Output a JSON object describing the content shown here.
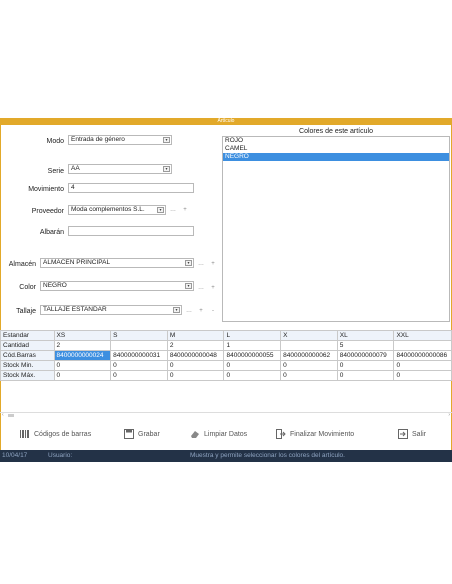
{
  "window": {
    "title": "Artículo"
  },
  "form": {
    "modo": {
      "label": "Modo",
      "value": "Entrada de género"
    },
    "serie": {
      "label": "Serie",
      "value": "AA"
    },
    "movimiento": {
      "label": "Movimiento",
      "value": "4"
    },
    "proveedor": {
      "label": "Proveedor",
      "value": "Moda complementos S.L."
    },
    "albaran": {
      "label": "Albarán",
      "value": ""
    },
    "almacen": {
      "label": "Almacén",
      "value": "ALMACEN PRINCIPAL"
    },
    "color": {
      "label": "Color",
      "value": "NEGRO"
    },
    "tallaje": {
      "label": "Tallaje",
      "value": "TALLAJE ESTANDAR"
    }
  },
  "colors": {
    "title": "Colores de este artículo",
    "items": [
      "ROJO",
      "CAMEL",
      "NEGRO"
    ],
    "selected": "NEGRO"
  },
  "grid": {
    "headers": [
      "Estandar",
      "XS",
      "S",
      "M",
      "L",
      "X",
      "XL",
      "XXL"
    ],
    "rows": [
      {
        "label": "Cantidad",
        "values": [
          "2",
          "",
          "2",
          "1",
          "",
          "5",
          ""
        ]
      },
      {
        "label": "Cód.Barras",
        "values": [
          "8400000000024",
          "8400000000031",
          "8400000000048",
          "8400000000055",
          "8400000000062",
          "8400000000079",
          "84000000000086"
        ]
      },
      {
        "label": "Stock Min.",
        "values": [
          "0",
          "0",
          "0",
          "0",
          "0",
          "0",
          "0"
        ]
      },
      {
        "label": "Stock Máx.",
        "values": [
          "0",
          "0",
          "0",
          "0",
          "0",
          "0",
          "0"
        ]
      }
    ]
  },
  "toolbar": {
    "codigos": "Códigos de barras",
    "grabar": "Grabar",
    "limpiar": "Limpiar Datos",
    "finalizar": "Finalizar Movimiento",
    "salir": "Salir"
  },
  "status": {
    "date": "10/04/17",
    "user": "Usuario:",
    "message": "Muestra y permite seleccionar los colores del artículo."
  },
  "colors_theme": {
    "accent": "#e2a92a",
    "selection": "#3d8fe0",
    "statusbar": "#233247"
  }
}
